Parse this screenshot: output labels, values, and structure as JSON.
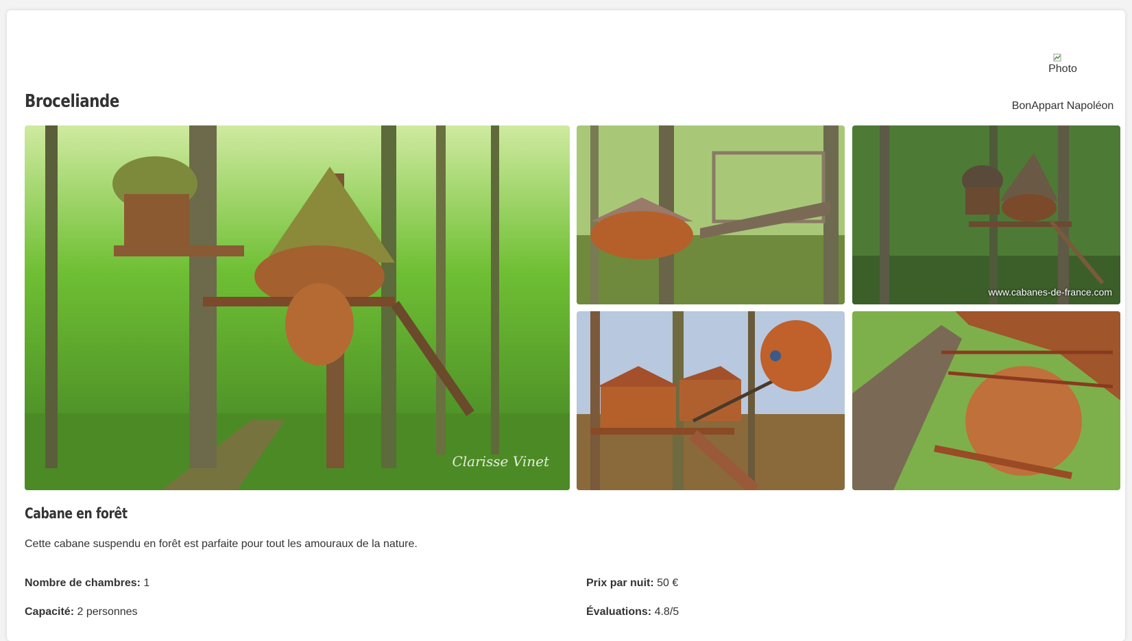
{
  "listing": {
    "title": "Broceliande",
    "subtitle": "Cabane en forêt",
    "description": "Cette cabane suspendu en forêt est parfaite pour tout les amouraux de la nature."
  },
  "host": {
    "photo_alt": "Photo",
    "name": "BonAppart Napoléon"
  },
  "gallery": {
    "watermark": "www.cabanes-de-france.com",
    "signature": "Clarisse Vinet"
  },
  "details": {
    "rooms_label": "Nombre de chambres:",
    "rooms_value": " 1",
    "capacity_label": "Capacité:",
    "capacity_value": " 2 personnes",
    "price_label": "Prix par nuit:",
    "price_value": " 50 €",
    "rating_label": "Évaluations:",
    "rating_value": " 4.8/5"
  },
  "colors": {
    "forest_green": "#5ea82f",
    "wood": "#b5652c",
    "text": "#333333"
  }
}
